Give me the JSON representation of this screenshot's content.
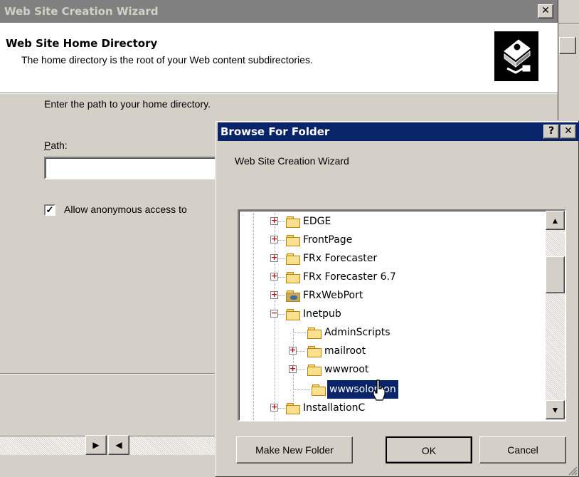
{
  "wizard": {
    "title": "Web Site Creation Wizard",
    "close_glyph": "✕",
    "header_title": "Web Site Home Directory",
    "header_subtitle": "The home directory is the root of your Web content subdirectories.",
    "instruction": "Enter the path to your home directory.",
    "path_label": "Path:",
    "path_value": "",
    "anonymous_label": "Allow anonymous access to",
    "anonymous_checked": true
  },
  "browse_dialog": {
    "title": "Browse For Folder",
    "help_glyph": "?",
    "close_glyph": "✕",
    "subtitle": "Web Site Creation Wizard",
    "tree": [
      {
        "label": "EDGE",
        "expander": "+",
        "icon": "folder-icon"
      },
      {
        "label": "FrontPage",
        "expander": "+",
        "icon": "folder-icon"
      },
      {
        "label": "FRx Forecaster",
        "expander": "+",
        "icon": "folder-icon"
      },
      {
        "label": "FRx Forecaster 6.7",
        "expander": "+",
        "icon": "folder-icon"
      },
      {
        "label": "FRxWebPort",
        "expander": "+",
        "icon": "web-folder-icon"
      },
      {
        "label": "Inetpub",
        "expander": "−",
        "icon": "folder-icon"
      },
      {
        "label": "AdminScripts",
        "expander": "",
        "icon": "folder-icon"
      },
      {
        "label": "mailroot",
        "expander": "+",
        "icon": "folder-icon"
      },
      {
        "label": "wwwroot",
        "expander": "+",
        "icon": "folder-icon"
      },
      {
        "label": "wwwsolomon",
        "expander": "",
        "icon": "folder-icon",
        "selected": true
      },
      {
        "label": "InstallationC",
        "expander": "+",
        "icon": "folder-icon"
      }
    ],
    "buttons": {
      "make_new_folder": "Make New Folder",
      "ok": "OK",
      "cancel": "Cancel"
    }
  },
  "colors": {
    "active_title": "#0a246a",
    "inactive_title": "#808080",
    "face": "#d4d0c8"
  }
}
